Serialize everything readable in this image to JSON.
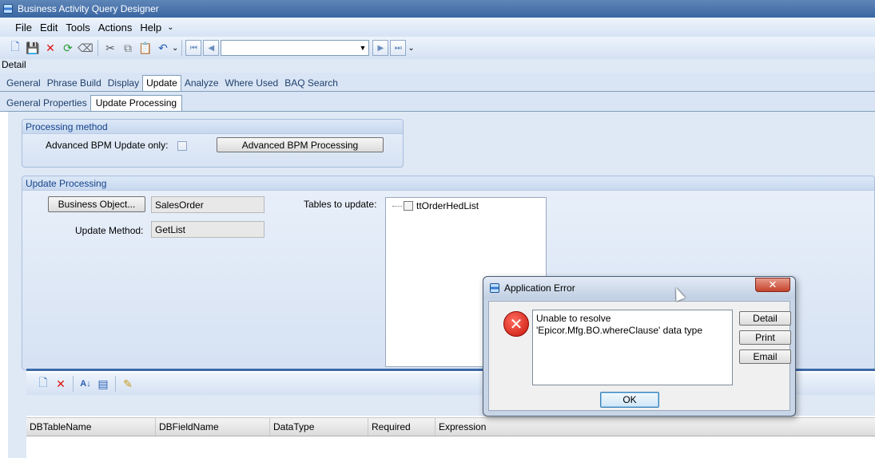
{
  "window": {
    "title": "Business Activity Query Designer"
  },
  "menu": {
    "items": [
      "File",
      "Edit",
      "Tools",
      "Actions",
      "Help"
    ]
  },
  "toolbar": {
    "icons": [
      "new-icon",
      "save-icon",
      "delete-icon",
      "refresh-icon",
      "clear-icon",
      "cut-icon",
      "copy-icon",
      "paste-icon",
      "undo-icon"
    ],
    "nav_combo_value": ""
  },
  "detail_label": "Detail",
  "tabs": [
    "General",
    "Phrase Build",
    "Display",
    "Update",
    "Analyze",
    "Where Used",
    "BAQ Search"
  ],
  "active_tab": "Update",
  "subtabs": [
    "General Properties",
    "Update  Processing"
  ],
  "active_subtab": "Update  Processing",
  "processing_method": {
    "title": "Processing method",
    "advanced_bpm_label": "Advanced BPM Update only:",
    "advanced_bpm_checked": false,
    "advanced_bpm_button": "Advanced BPM Processing"
  },
  "update_processing": {
    "title": "Update Processing",
    "business_object_button": "Business Object...",
    "business_object_value": "SalesOrder",
    "update_method_label": "Update Method:",
    "update_method_value": "GetList",
    "tables_label": "Tables to update:",
    "tables": [
      {
        "name": "ttOrderHedList",
        "checked": false
      }
    ]
  },
  "grid": {
    "columns": [
      "DBTableName",
      "DBFieldName",
      "DataType",
      "Required",
      "Expression"
    ]
  },
  "dialog": {
    "title": "Application Error",
    "message_line1": "Unable to resolve",
    "message_line2": "'Epicor.Mfg.BO.whereClause' data type",
    "detail_button": "Detail",
    "print_button": "Print",
    "email_button": "Email",
    "ok_button": "OK",
    "close_glyph": "✕",
    "error_glyph": "✕"
  }
}
